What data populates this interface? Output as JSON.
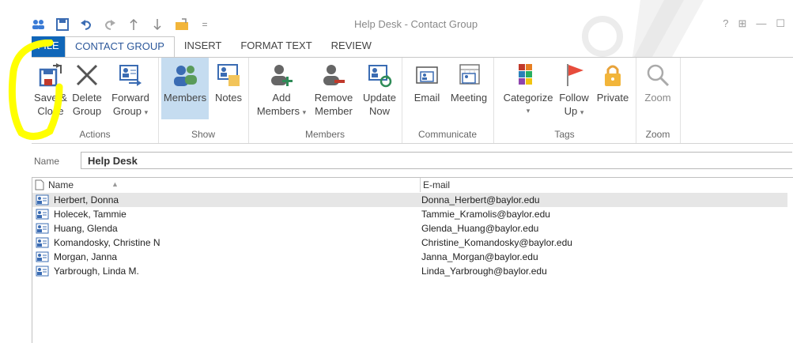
{
  "window": {
    "title": "Help Desk - Contact Group"
  },
  "qat": {
    "items": [
      "contact-group-icon",
      "save-icon",
      "undo-icon",
      "redo-icon",
      "up-icon",
      "down-icon",
      "attach-icon",
      "customize-icon"
    ],
    "customize_glyph": "="
  },
  "window_controls": {
    "help": "?",
    "restore_ribbon": "⊞",
    "minimize": "—",
    "maximize": "☐"
  },
  "tabs": [
    {
      "label": "FILE"
    },
    {
      "label": "CONTACT GROUP"
    },
    {
      "label": "INSERT"
    },
    {
      "label": "FORMAT TEXT"
    },
    {
      "label": "REVIEW"
    }
  ],
  "ribbon": {
    "groups": {
      "actions": "Actions",
      "show": "Show",
      "members": "Members",
      "communicate": "Communicate",
      "tags": "Tags",
      "zoom": "Zoom"
    },
    "buttons": {
      "save_close": [
        "Save &",
        "Close"
      ],
      "delete_group": [
        "Delete",
        "Group"
      ],
      "forward_group": [
        "Forward",
        "Group"
      ],
      "members": [
        "Members"
      ],
      "notes": [
        "Notes"
      ],
      "add_members": [
        "Add",
        "Members"
      ],
      "remove_member": [
        "Remove",
        "Member"
      ],
      "update_now": [
        "Update",
        "Now"
      ],
      "email": [
        "Email"
      ],
      "meeting": [
        "Meeting"
      ],
      "categorize": [
        "Categorize"
      ],
      "follow_up": [
        "Follow",
        "Up"
      ],
      "private": [
        "Private"
      ],
      "zoom": [
        "Zoom"
      ]
    },
    "drop_arrow": "▾"
  },
  "name_field": {
    "label": "Name",
    "value": "Help Desk"
  },
  "list": {
    "headers": {
      "name": "Name",
      "email": "E-mail",
      "sort": "▲"
    },
    "rows": [
      {
        "name": "Herbert, Donna",
        "email": "Donna_Herbert@baylor.edu",
        "selected": true
      },
      {
        "name": "Holecek, Tammie",
        "email": "Tammie_Kramolis@baylor.edu"
      },
      {
        "name": "Huang, Glenda",
        "email": "Glenda_Huang@baylor.edu"
      },
      {
        "name": "Komandosky, Christine N",
        "email": "Christine_Komandosky@baylor.edu"
      },
      {
        "name": "Morgan, Janna",
        "email": "Janna_Morgan@baylor.edu"
      },
      {
        "name": "Yarbrough, Linda M.",
        "email": "Linda_Yarbrough@baylor.edu"
      }
    ]
  },
  "colors": {
    "file_tab": "#1066b8",
    "active_tab_text": "#2b579a",
    "selected_button": "#c5dcf0",
    "highlight": "#ffff00"
  }
}
